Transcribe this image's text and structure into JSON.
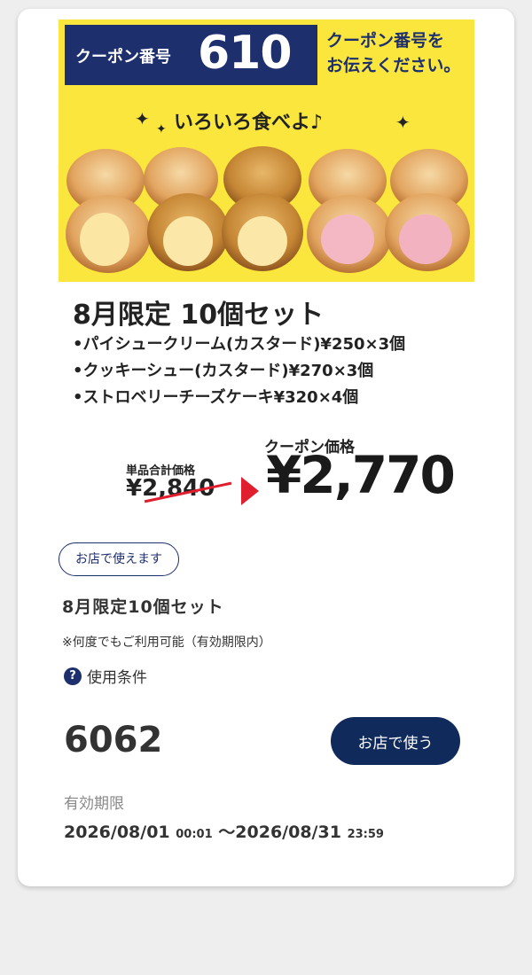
{
  "banner": {
    "coupon_label": "クーポン番号",
    "coupon_number": "610",
    "tell_line1": "クーポン番号を",
    "tell_line2": "お伝えください。",
    "catchphrase": "いろいろ食べよ♪",
    "colors": {
      "yellow": "#fae63c",
      "navy": "#1e2f6e"
    }
  },
  "product": {
    "title": "8月限定 10個セット",
    "items": [
      "•パイシュークリーム(カスタード)¥250×3個",
      "•クッキーシュー(カスタード)¥270×3個",
      "•ストロベリーチーズケーキ¥320×4個"
    ]
  },
  "price": {
    "sum_label": "単品合計価格",
    "old_price": "¥2,840",
    "coupon_price_label": "クーポン価格",
    "coupon_price": "¥2,770",
    "accent": "#e01e2e"
  },
  "details": {
    "store_tag": "お店で使えます",
    "name": "8月限定10個セット",
    "note": "※何度でもご利用可能（有効期限内）",
    "conditions_label": "使用条件",
    "code": "6062",
    "use_button": "お店で使う",
    "validity_label": "有効期限",
    "valid_from_date": "2026/08/01",
    "valid_from_time": "00:01",
    "valid_sep": "～",
    "valid_to_date": "2026/08/31",
    "valid_to_time": "23:59"
  }
}
